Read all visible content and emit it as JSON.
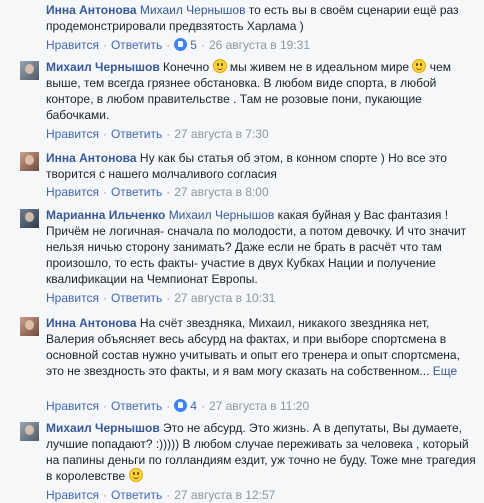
{
  "comments": [
    {
      "author": "Инна Антонова",
      "mention": "Михаил Чернышов",
      "text1": " то есть вы в своём сценарии ещё раз продемонстрировали предвзятость Харлама )",
      "actions": {
        "like": "Нравится",
        "reply": "Ответить",
        "like_count": "5",
        "time": "26 августа в 19:31"
      }
    },
    {
      "author": "Михаил Чернышов",
      "text1": " Конечно ",
      "text2": " мы живем не в идеальном мире ",
      "text3": " чем выше, тем всегда грязнее обстановка. В любом виде спорта, в любой конторе, в любом правительстве . Там не розовые пони, пукающие бабочками.",
      "actions": {
        "like": "Нравится",
        "reply": "Ответить",
        "time": "27 августа в 7:30"
      }
    },
    {
      "author": "Инна Антонова",
      "text1": " Ну как бы статья об этом, в конном спорте ) Но все это творится с нашего молчаливого согласия",
      "actions": {
        "like": "Нравится",
        "reply": "Ответить",
        "time": "27 августа в 8:00"
      }
    },
    {
      "author": "Марианна Ильченко",
      "mention": "Михаил Чернышов",
      "text1": " какая буйная у Вас фантазия ! Причём не логичная- сначала по молодости, а потом девочку. И что значит нельзя ничью сторону занимать? Даже если не брать в расчёт что там произошло, то есть факты- участие в двух Кубках Нации и получение квалификации на Чемпионат Европы.",
      "actions": {
        "like": "Нравится",
        "reply": "Ответить",
        "time": "27 августа в 10:31"
      }
    },
    {
      "author": "Инна Антонова",
      "text1": " На счёт звездняка, Михаил, никакого звездняка нет, Валерия объясняет весь абсурд на фактах, и при выборе спортсмена в основной состав нужно учитывать и опыт его тренера и опыт спортсмена, это не звездность это факты, и я вам могу сказать на собственном...",
      "more": "Еще",
      "actions": {
        "like": "Нравится",
        "reply": "Ответить",
        "like_count": "4",
        "time": "27 августа в 11:20"
      }
    },
    {
      "author": "Михаил Чернышов",
      "text1": " Это не абсурд. Это жизнь. А в депутаты, Вы думаете, лучшие попадают? :))))) В любом случае переживать за человека , который на папины деньги по голландиям ездит, уж точно не буду. Тоже мне трагедия в королевстве ",
      "actions": {
        "like": "Нравится",
        "reply": "Ответить",
        "time": "27 августа в 12:57"
      }
    }
  ]
}
